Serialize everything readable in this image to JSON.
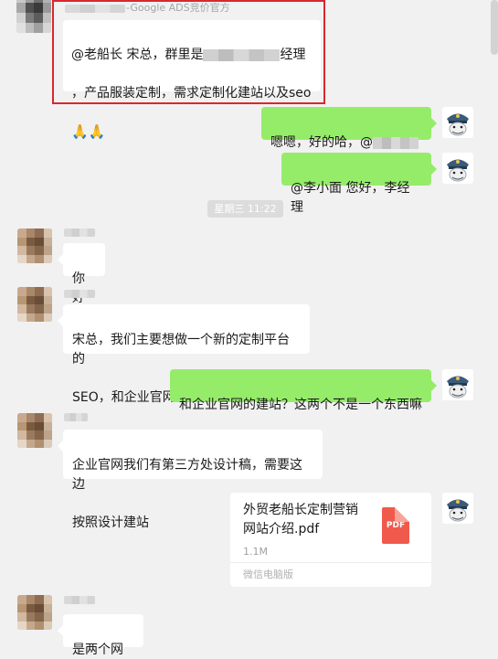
{
  "header_message": {
    "sender_suffix": "-Google ADS竞价官方",
    "line1_prefix": "@老船长 宋总，群里是",
    "line1_suffix": "经理",
    "line2": "，产品服装定制，需求定制化建站以及seo",
    "emoji": "🙏🙏"
  },
  "messages": {
    "self1_prefix": "嗯嗯，好的哈，@",
    "self2": "@李小面 您好，李经理",
    "time_label": "星期三 11:22",
    "other1": "你好",
    "other2_line1": "宋总，我们主要想做一个新的定制平台的",
    "other2_line2": "SEO，和企业官网的建站",
    "self3": "和企业官网的建站？这两个不是一个东西嘛",
    "other3_line1": "企业官网我们有第三方处设计稿，需要这边",
    "other3_line2": "按照设计建站",
    "other4": "是两个网站"
  },
  "file": {
    "name_line1": "外贸老船长定制营销",
    "name_line2": "网站介绍.pdf",
    "size": "1.1M",
    "source": "微信电脑版",
    "icon_label": "PDF"
  },
  "colors": {
    "self_bubble": "#95ec69",
    "other_bubble": "#ffffff",
    "highlight": "#d9272e",
    "pdf": "#f05a4c"
  }
}
